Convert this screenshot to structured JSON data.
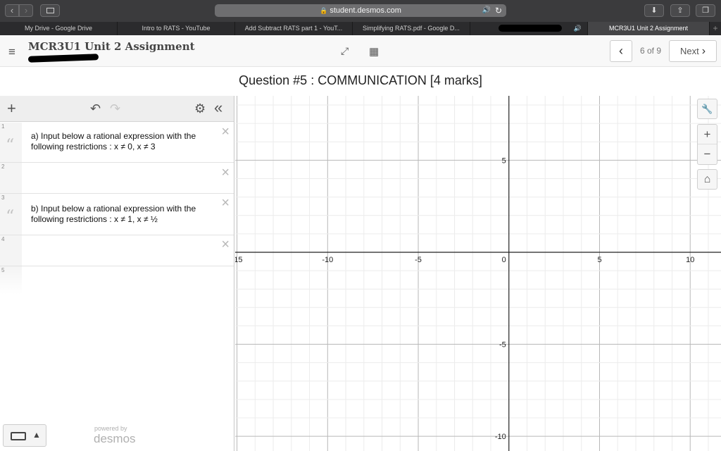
{
  "browser": {
    "back_glyph": "‹",
    "forward_glyph": "›",
    "url": "student.desmos.com",
    "lock_glyph": "🔒",
    "audio_glyph": "🔊",
    "reload_glyph": "↻",
    "download_glyph": "⬇",
    "share_glyph": "⇪",
    "tabs_glyph": "❐",
    "tabs": [
      {
        "label": "My Drive - Google Drive"
      },
      {
        "label": "Intro to RATS - YouTube"
      },
      {
        "label": "Add Subtract RATS part 1 - YouT..."
      },
      {
        "label": "Simplifying RATS.pdf - Google D..."
      },
      {
        "label": ""
      },
      {
        "label": "MCR3U1 Unit 2 Assignment"
      }
    ],
    "new_tab_glyph": "+"
  },
  "header": {
    "menu_glyph": "≡",
    "assignment_title": "MCR3U1 Unit 2 Assignment",
    "fullscreen_glyph": "⤢",
    "calculator_glyph": "▦",
    "prev_glyph": "‹",
    "page_indicator": "6 of 9",
    "next_label": "Next",
    "next_glyph": "›"
  },
  "question": {
    "title": "Question #5 : COMMUNICATION [4 marks]"
  },
  "expression_panel": {
    "add_glyph": "+",
    "undo_glyph": "↶",
    "redo_glyph": "↷",
    "settings_glyph": "⚙",
    "collapse_glyph": "«",
    "rows": [
      {
        "index": "1",
        "type": "note",
        "text": "a) Input below a rational expression with the following restrictions : x ≠ 0, x ≠  3"
      },
      {
        "index": "2",
        "type": "expression",
        "text": ""
      },
      {
        "index": "3",
        "type": "note",
        "text": "b) Input below a rational expression with the following restrictions : x ≠ 1, x ≠ ½"
      },
      {
        "index": "4",
        "type": "expression",
        "text": ""
      },
      {
        "index": "5",
        "type": "empty",
        "text": ""
      }
    ],
    "quote_glyph": "“",
    "delete_glyph": "×",
    "keypad_caret": "▲",
    "powered_by": "powered by",
    "brand": "desmos"
  },
  "graph": {
    "wrench_glyph": "🔧",
    "zoom_in_glyph": "+",
    "zoom_out_glyph": "−",
    "home_glyph": "⌂",
    "x_range": [
      -15.1,
      11.7
    ],
    "y_range": [
      -10.8,
      8.5
    ],
    "x_tick_labels": [
      "-15",
      "-10",
      "-5",
      "0",
      "5",
      "10"
    ],
    "y_tick_labels": [
      "5",
      "-5",
      "-10"
    ],
    "major_step": 5,
    "minor_step": 1,
    "grid": true
  }
}
